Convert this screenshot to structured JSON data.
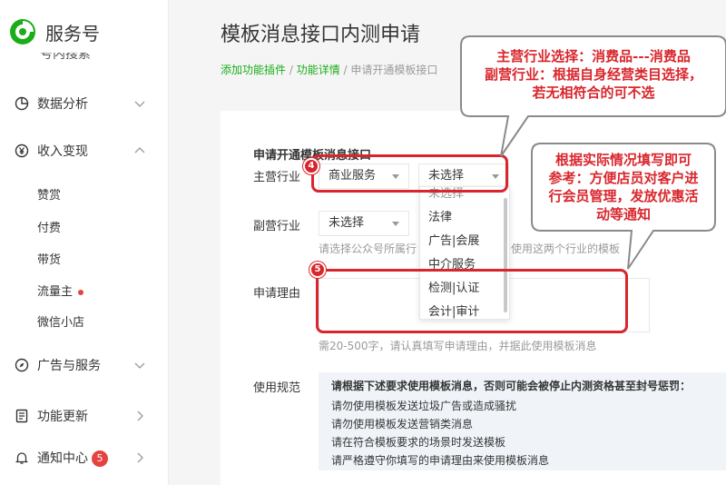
{
  "brand": {
    "name": "服务号",
    "color": "#1aad19"
  },
  "sidebar": {
    "cut_item": "号内搜索",
    "groups": [
      {
        "label": "数据分析",
        "icon": "chart-pie-icon",
        "chevron": "chevron-down-icon"
      },
      {
        "label": "收入变现",
        "icon": "yen-icon",
        "chevron": "chevron-up-icon"
      },
      {
        "label": "广告与服务",
        "icon": "compass-icon",
        "chevron": "chevron-down-icon"
      },
      {
        "label": "功能更新",
        "icon": "doc-icon",
        "chevron": "chevron-right-icon"
      },
      {
        "label": "通知中心",
        "icon": "bell-icon",
        "chevron": "chevron-right-icon",
        "badge": "5"
      }
    ],
    "sub_items": [
      "赞赏",
      "付费",
      "带货",
      "流量主",
      "微信小店"
    ]
  },
  "page": {
    "title": "模板消息接口内测申请",
    "breadcrumb": {
      "link1": "添加功能插件",
      "sep1": " / ",
      "link2": "功能详情",
      "sep2": " / ",
      "current": "申请开通模板接口"
    }
  },
  "form": {
    "section_title": "申请开通模板消息接口",
    "primary_label": "主营行业",
    "primary_select1": "商业服务",
    "primary_select2": "未选择",
    "secondary_label": "副营行业",
    "secondary_select": "未选择",
    "industry_hint_left": "请选择公众号所属行",
    "industry_hint_right": "使用这两个行业的模板",
    "reason_label": "申请理由",
    "reason_hint": "需20-500字，请认真填写申请理由，并据此使用模板消息",
    "rules_label": "使用规范",
    "dropdown_options": [
      "未选择",
      "法律",
      "广告|会展",
      "中介服务",
      "检测|认证",
      "会计|审计"
    ]
  },
  "rules": {
    "heading": "请根据下述要求使用模板消息，否则可能会被停止内测资格甚至封号惩罚：",
    "lines": [
      "请勿使用模板发送垃圾广告或造成骚扰",
      "请勿使用模板发送营销类消息",
      "请在符合模板要求的场景时发送模板",
      "请严格遵守你填写的申请理由来使用模板消息"
    ]
  },
  "annotations": {
    "color": "#d9262c",
    "badge4": "4",
    "badge5": "5",
    "callout1": {
      "line1": "主营行业选择：消费品---消费品",
      "line2": "副营行业：根据自身经营类目选择，",
      "line3": "若无相符合的可不选"
    },
    "callout2": {
      "line1": "根据实际情况填写即可",
      "line2": "参考：方便店员对客户进",
      "line3": "行会员管理，发放优惠活",
      "line4": "动等通知"
    }
  }
}
